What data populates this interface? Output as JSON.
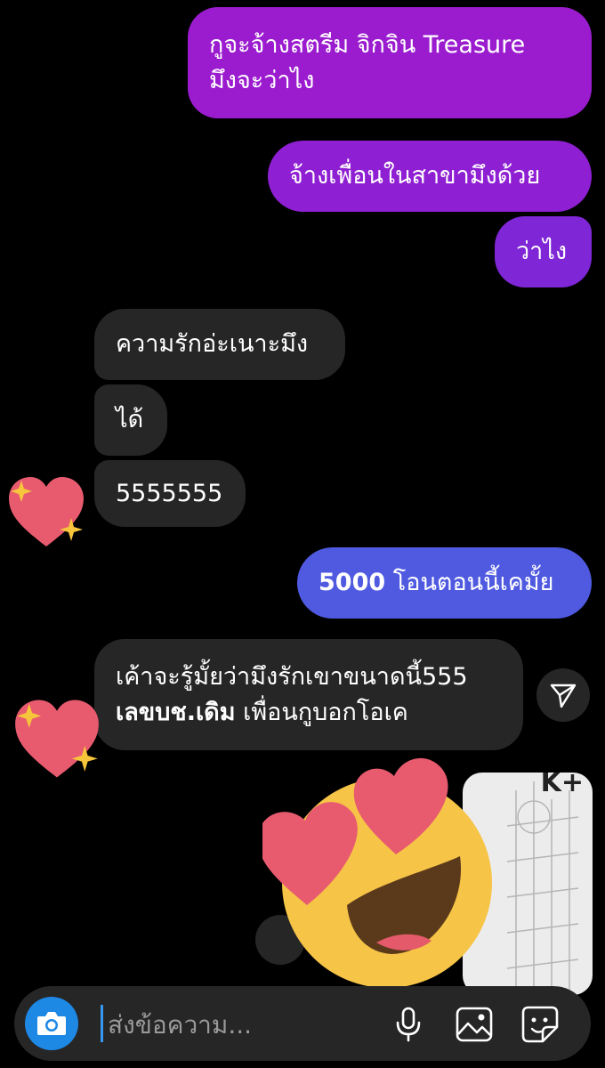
{
  "colors": {
    "background": "#000000",
    "received_bubble": "#262626",
    "sent_gradient_top": "#a01cc4",
    "sent_gradient_bottom": "#4b5fe0",
    "camera_button": "#1e88e5"
  },
  "messages": [
    {
      "side": "sent",
      "lines": [
        "กูจะจ้างสตรีม จิกจิน Treasure",
        "มึงจะว่าไง"
      ]
    },
    {
      "side": "sent",
      "lines": [
        "จ้างเพื่อนในสาขามึงด้วย"
      ]
    },
    {
      "side": "sent",
      "lines": [
        "ว่าไง"
      ]
    },
    {
      "side": "received",
      "lines": [
        "ความรักอ่ะเนาะมึง"
      ]
    },
    {
      "side": "received",
      "lines": [
        "ได้"
      ]
    },
    {
      "side": "received",
      "lines": [
        "5555555"
      ],
      "reaction": "sparkling-heart"
    },
    {
      "side": "sent",
      "bold": "5000",
      "text": " โอนตอนนี้เคมั้ย"
    },
    {
      "side": "received",
      "line1": "เค้าจะรู้มั้ยว่ามึงรักเขาขนาดนี้555",
      "bold": "เลขบช.เดิม",
      "text": " เพื่อนกูบอกโอเค",
      "reaction": "sparkling-heart"
    }
  ],
  "attachment": {
    "visible_text": "K+"
  },
  "overlay_sticker": "smiling-face-with-heart-eyes",
  "composer": {
    "placeholder": "ส่งข้อความ...",
    "icons": [
      "camera-icon",
      "microphone-icon",
      "image-icon",
      "sticker-icon"
    ]
  }
}
